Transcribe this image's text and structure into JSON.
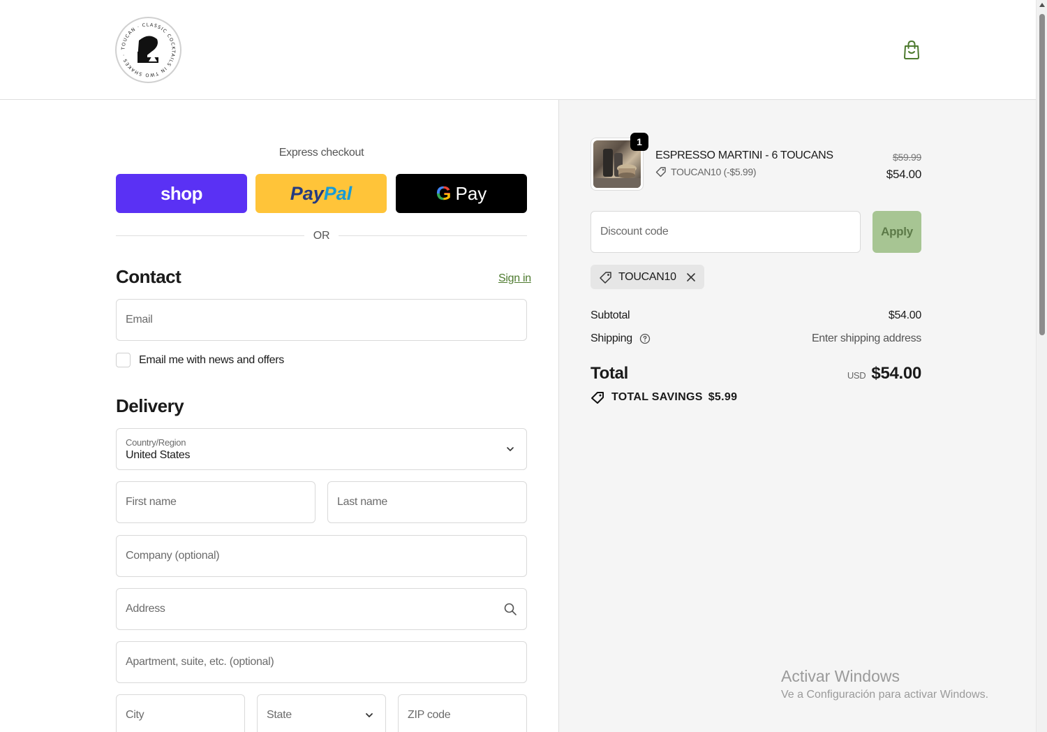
{
  "header": {
    "logo_text": "TOUCAN · CLASSIC COCKTAILS IN TWO SHAKES",
    "cart_icon": "shopping-bag-icon",
    "accent_color": "#4d7a2e"
  },
  "express": {
    "title": "Express checkout",
    "shop_label": "shop",
    "paypal_label_1": "Pay",
    "paypal_label_2": "Pal",
    "gpay_g": "G",
    "gpay_label": "Pay",
    "divider_text": "OR"
  },
  "contact": {
    "title": "Contact",
    "signin_label": "Sign in",
    "email_placeholder": "Email",
    "newsletter_label": "Email me with news and offers",
    "newsletter_checked": false
  },
  "delivery": {
    "title": "Delivery",
    "country_label": "Country/Region",
    "country_value": "United States",
    "first_name_placeholder": "First name",
    "last_name_placeholder": "Last name",
    "company_placeholder": "Company (optional)",
    "address_placeholder": "Address",
    "apartment_placeholder": "Apartment, suite, etc. (optional)",
    "city_placeholder": "City",
    "state_placeholder": "State",
    "zip_placeholder": "ZIP code"
  },
  "summary": {
    "item": {
      "quantity": "1",
      "name": "ESPRESSO MARTINI - 6 TOUCANS",
      "discount_line": "TOUCAN10 (-$5.99)",
      "original_price": "$59.99",
      "price": "$54.00"
    },
    "discount_placeholder": "Discount code",
    "apply_label": "Apply",
    "applied_code": "TOUCAN10",
    "subtotal_label": "Subtotal",
    "subtotal_value": "$54.00",
    "shipping_label": "Shipping",
    "shipping_value": "Enter shipping address",
    "total_label": "Total",
    "currency": "USD",
    "total_value": "$54.00",
    "savings_label": "TOTAL SAVINGS",
    "savings_value": "$5.99"
  },
  "watermark": {
    "title": "Activar Windows",
    "subtitle": "Ve a Configuración para activar Windows."
  }
}
